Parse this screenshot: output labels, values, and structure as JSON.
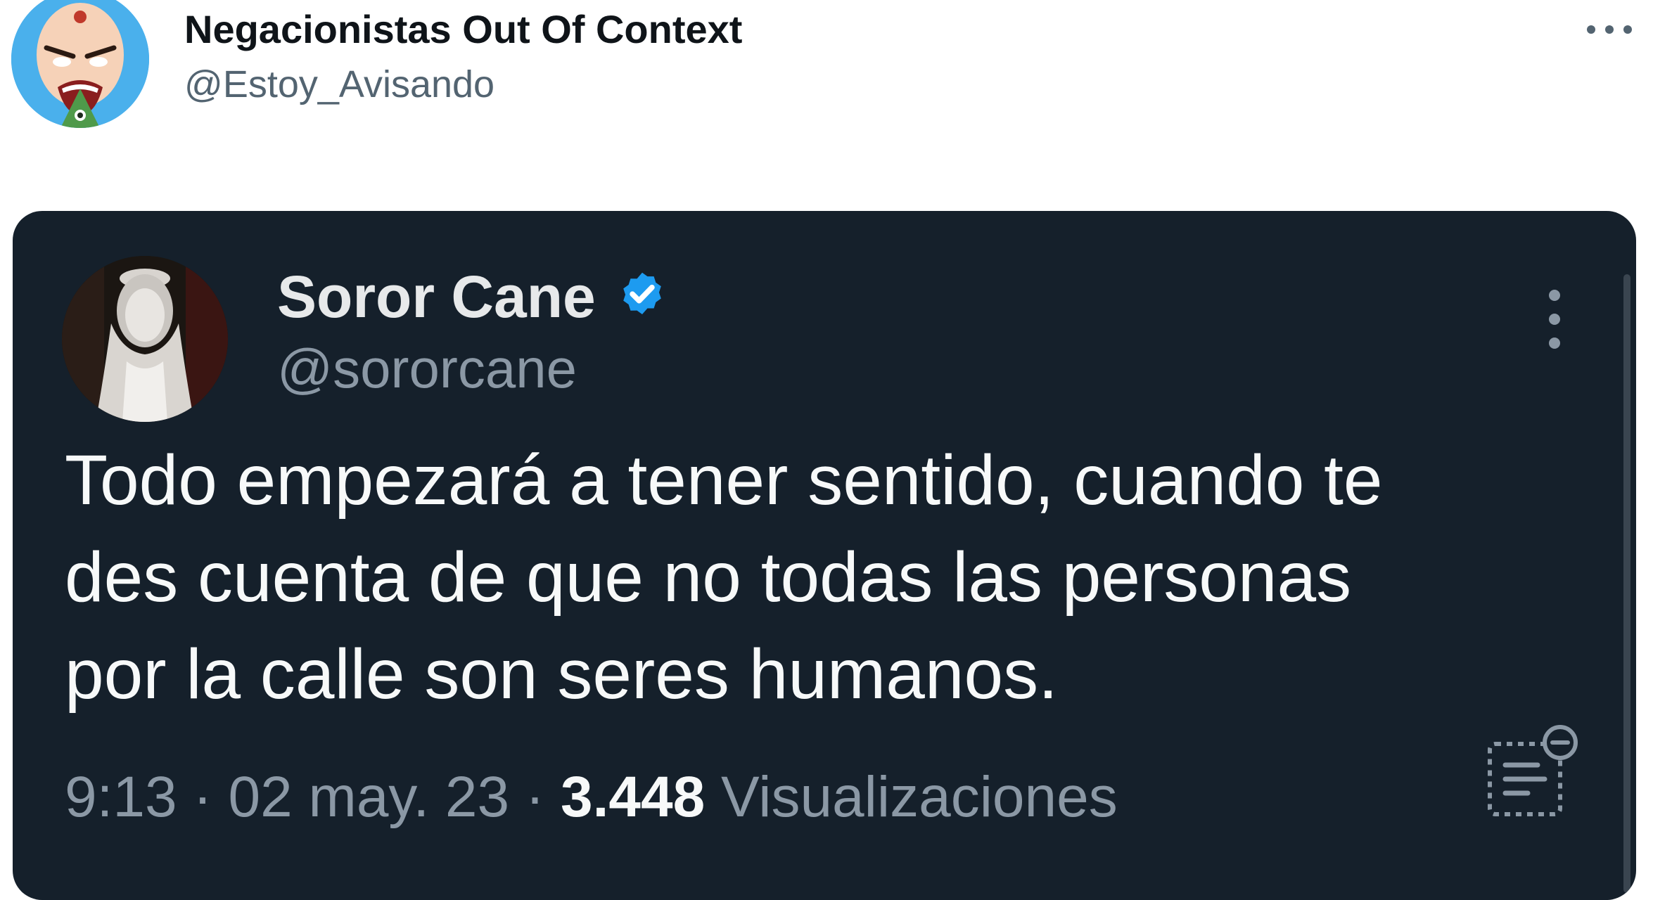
{
  "outer_tweet": {
    "author_name": "Negacionistas Out Of Context",
    "author_handle": "@Estoy_Avisando",
    "more_icon": "more-horizontal-icon"
  },
  "quoted_tweet": {
    "author_name": "Soror Cane",
    "author_handle": "@sororcane",
    "verified_icon": "verified-badge-icon",
    "more_icon": "more-vertical-icon",
    "text_lines": [
      "Todo empezará a tener sentido, cuando te",
      "des cuenta de que no todas las personas",
      "por la calle son seres humanos."
    ],
    "time": "9:13",
    "separator": "·",
    "date": "02 may. 23",
    "views_count": "3.448",
    "views_label": "Visualizaciones",
    "notes_icon": "community-notes-icon"
  },
  "colors": {
    "card_background": "#15202b",
    "verified_blue": "#1d9bf0",
    "primary_text_dark": "#0f1419",
    "secondary_text_light": "#536471",
    "secondary_text_dark": "#8b98a5"
  }
}
